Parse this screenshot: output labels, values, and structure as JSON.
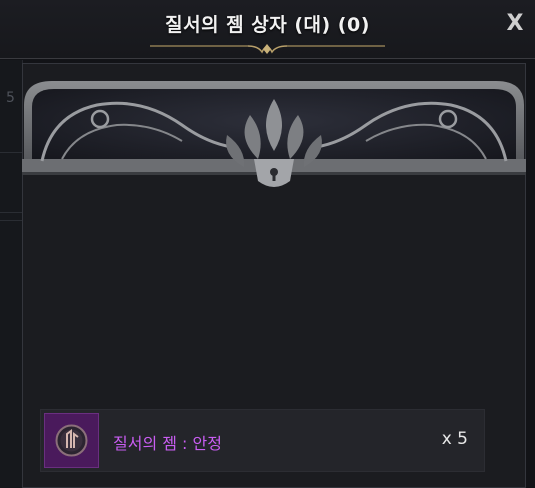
{
  "title": "질서의 젬 상자 (대) (0)",
  "close_label": "X",
  "background_hud": {
    "cells": [
      "42",
      "2",
      "2",
      "2",
      "1093",
      "27"
    ],
    "side_number": "5"
  },
  "item": {
    "name": "질서의 젬 : 안정",
    "quantity": "x 5",
    "name_color": "#c95df2",
    "icon": "order-gem-icon"
  }
}
